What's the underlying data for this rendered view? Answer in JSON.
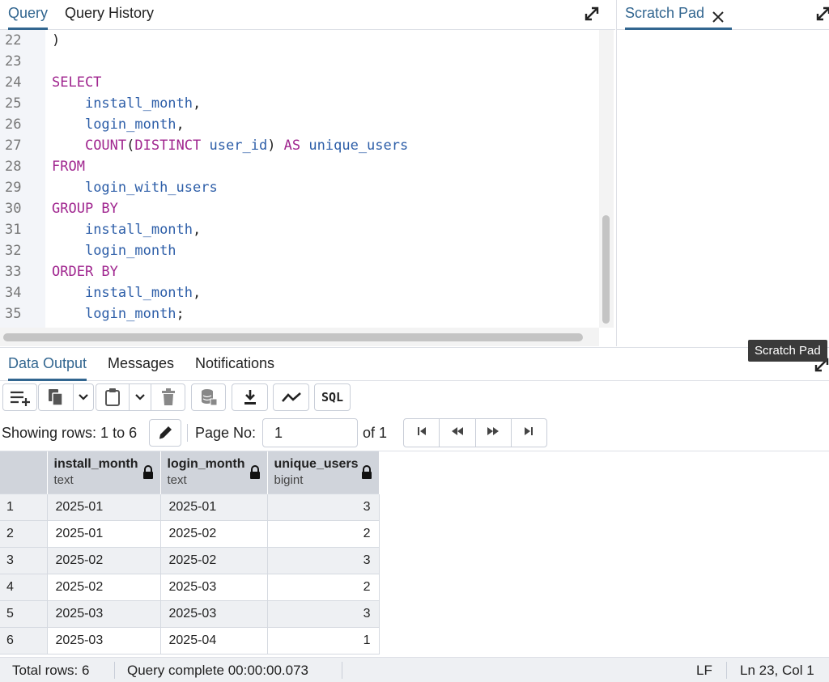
{
  "editor": {
    "tabs": [
      {
        "label": "Query",
        "active": true
      },
      {
        "label": "Query History",
        "active": false
      }
    ],
    "lines": [
      {
        "num": "22",
        "tokens": [
          {
            "t": "punct",
            "v": ")"
          }
        ]
      },
      {
        "num": "23",
        "tokens": []
      },
      {
        "num": "24",
        "tokens": [
          {
            "t": "keyword",
            "v": "SELECT"
          }
        ]
      },
      {
        "num": "25",
        "tokens": [
          {
            "t": "punct",
            "v": "    "
          },
          {
            "t": "ident",
            "v": "install_month"
          },
          {
            "t": "punct",
            "v": ","
          }
        ]
      },
      {
        "num": "26",
        "tokens": [
          {
            "t": "punct",
            "v": "    "
          },
          {
            "t": "ident",
            "v": "login_month"
          },
          {
            "t": "punct",
            "v": ","
          }
        ]
      },
      {
        "num": "27",
        "tokens": [
          {
            "t": "punct",
            "v": "    "
          },
          {
            "t": "keyword",
            "v": "COUNT"
          },
          {
            "t": "punct",
            "v": "("
          },
          {
            "t": "keyword",
            "v": "DISTINCT"
          },
          {
            "t": "punct",
            "v": " "
          },
          {
            "t": "ident",
            "v": "user_id"
          },
          {
            "t": "punct",
            "v": ") "
          },
          {
            "t": "keyword",
            "v": "AS"
          },
          {
            "t": "punct",
            "v": " "
          },
          {
            "t": "ident",
            "v": "unique_users"
          }
        ]
      },
      {
        "num": "28",
        "tokens": [
          {
            "t": "keyword",
            "v": "FROM"
          }
        ]
      },
      {
        "num": "29",
        "tokens": [
          {
            "t": "punct",
            "v": "    "
          },
          {
            "t": "ident",
            "v": "login_with_users"
          }
        ]
      },
      {
        "num": "30",
        "tokens": [
          {
            "t": "keyword",
            "v": "GROUP BY"
          }
        ]
      },
      {
        "num": "31",
        "tokens": [
          {
            "t": "punct",
            "v": "    "
          },
          {
            "t": "ident",
            "v": "install_month"
          },
          {
            "t": "punct",
            "v": ","
          }
        ]
      },
      {
        "num": "32",
        "tokens": [
          {
            "t": "punct",
            "v": "    "
          },
          {
            "t": "ident",
            "v": "login_month"
          }
        ]
      },
      {
        "num": "33",
        "tokens": [
          {
            "t": "keyword",
            "v": "ORDER BY"
          }
        ]
      },
      {
        "num": "34",
        "tokens": [
          {
            "t": "punct",
            "v": "    "
          },
          {
            "t": "ident",
            "v": "install_month"
          },
          {
            "t": "punct",
            "v": ","
          }
        ]
      },
      {
        "num": "35",
        "tokens": [
          {
            "t": "punct",
            "v": "    "
          },
          {
            "t": "ident",
            "v": "login_month"
          },
          {
            "t": "punct",
            "v": ";"
          }
        ]
      }
    ]
  },
  "scratch": {
    "tab_label": "Scratch Pad",
    "tooltip": "Scratch Pad"
  },
  "output": {
    "tabs": [
      {
        "label": "Data Output",
        "active": true
      },
      {
        "label": "Messages",
        "active": false
      },
      {
        "label": "Notifications",
        "active": false
      }
    ]
  },
  "toolbar": {
    "icons": [
      "add-row-icon",
      "copy-icon",
      "chevron-down-icon",
      "paste-icon",
      "chevron-down-icon",
      "delete-icon",
      "save-data-icon",
      "download-icon",
      "graph-icon",
      "sql-icon"
    ],
    "sql_label": "SQL"
  },
  "pager": {
    "showing_label": "Showing rows: 1 to 6",
    "page_label": "Page No:",
    "page_value": "1",
    "of_label": "of 1"
  },
  "grid": {
    "columns": [
      {
        "name": "install_month",
        "type": "text"
      },
      {
        "name": "login_month",
        "type": "text"
      },
      {
        "name": "unique_users",
        "type": "bigint"
      }
    ],
    "rows": [
      {
        "num": "1",
        "cells": [
          "2025-01",
          "2025-01",
          "3"
        ]
      },
      {
        "num": "2",
        "cells": [
          "2025-01",
          "2025-02",
          "2"
        ]
      },
      {
        "num": "3",
        "cells": [
          "2025-02",
          "2025-02",
          "3"
        ]
      },
      {
        "num": "4",
        "cells": [
          "2025-02",
          "2025-03",
          "2"
        ]
      },
      {
        "num": "5",
        "cells": [
          "2025-03",
          "2025-03",
          "3"
        ]
      },
      {
        "num": "6",
        "cells": [
          "2025-03",
          "2025-04",
          "1"
        ]
      }
    ]
  },
  "status": {
    "total_rows": "Total rows: 6",
    "query_status": "Query complete 00:00:00.073",
    "line_ending": "LF",
    "cursor": "Ln 23, Col 1"
  },
  "colors": {
    "accent": "#326690",
    "keyword": "#a0268f",
    "identifier": "#2d5ea8",
    "header_bg": "#d0d4db",
    "stripe_bg": "#eef0f3"
  }
}
